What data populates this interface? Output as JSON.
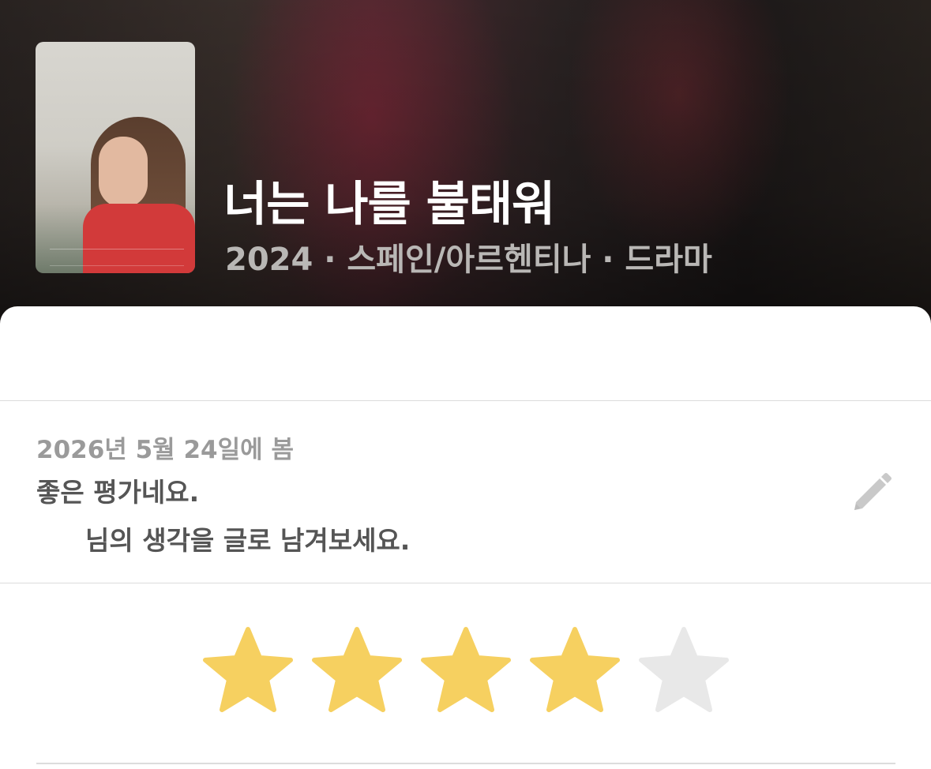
{
  "movie": {
    "title": "너는 나를 불태워",
    "meta": "2024 · 스페인/아르헨티나 · 드라마",
    "poster_icon": "movie-poster-image"
  },
  "review": {
    "watched_date": "2026년 5월 24일에 봄",
    "message_line1": "좋은 평가네요.",
    "message_line2": "님의 생각을 글로 남겨보세요.",
    "edit_icon": "pencil-icon"
  },
  "rating": {
    "value": 4,
    "max": 5,
    "filled_color": "#F6D060",
    "empty_color": "#E8E8E8"
  }
}
